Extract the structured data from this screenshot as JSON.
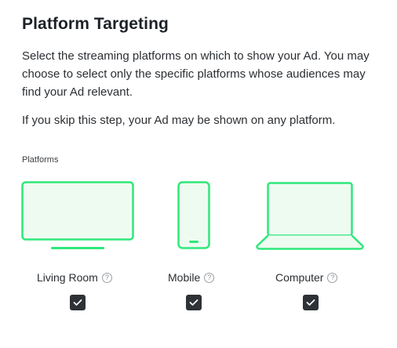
{
  "header": {
    "title": "Platform Targeting"
  },
  "description": "Select the streaming platforms on which to show your Ad. You may choose to select only the specific platforms whose audiences may find your Ad relevant.",
  "skip_note": "If you skip this step, your Ad may be shown on any platform.",
  "platforms": {
    "section_label": "Platforms",
    "items": [
      {
        "label": "Living Room",
        "icon": "tv-icon",
        "help_icon": "?",
        "checked": true
      },
      {
        "label": "Mobile",
        "icon": "phone-icon",
        "help_icon": "?",
        "checked": true
      },
      {
        "label": "Computer",
        "icon": "laptop-icon",
        "help_icon": "?",
        "checked": true
      }
    ]
  },
  "colors": {
    "accent": "#2ee87a",
    "device_fill": "#eefbf1",
    "checkbox": "#2e3236"
  }
}
